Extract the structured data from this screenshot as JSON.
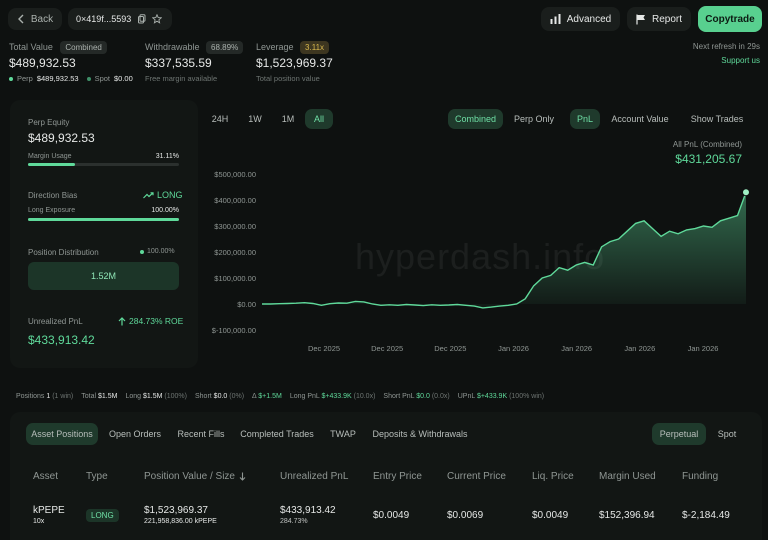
{
  "header": {
    "back_label": "Back",
    "address": "0×419f...5593",
    "advanced_label": "Advanced",
    "report_label": "Report",
    "copytrade_label": "Copytrade",
    "refresh_text": "Next refresh in 29s",
    "support_label": "Support us"
  },
  "summary": {
    "total_value_label": "Total Value",
    "total_value_badge": "Combined",
    "total_value": "$489,932.53",
    "perp_label": "Perp",
    "perp_value": "$489,932.53",
    "spot_label": "Spot",
    "spot_value": "$0.00",
    "withdrawable_label": "Withdrawable",
    "withdrawable_pct": "68.89%",
    "withdrawable_value": "$337,535.59",
    "withdrawable_sub": "Free margin available",
    "leverage_label": "Leverage",
    "leverage_badge": "3.11x",
    "leverage_value": "$1,523,969.37",
    "leverage_sub": "Total position value"
  },
  "left_panel": {
    "perp_equity_label": "Perp Equity",
    "perp_equity_value": "$489,932.53",
    "margin_usage_label": "Margin Usage",
    "margin_usage_value": "31.11%",
    "margin_usage_fraction": 0.3111,
    "direction_bias_label": "Direction Bias",
    "direction_bias_value": "LONG",
    "long_exposure_label": "Long Exposure",
    "long_exposure_value": "100.00%",
    "long_exposure_fraction": 1.0,
    "position_distribution_label": "Position Distribution",
    "position_distribution_value": "100.00%",
    "position_distribution_amount": "1.52M",
    "unrealized_pnl_label": "Unrealized PnL",
    "unrealized_roe": "284.73% ROE",
    "unrealized_pnl_value": "$433,913.42"
  },
  "chart_controls": {
    "ranges": [
      "24H",
      "1W",
      "1M",
      "All"
    ],
    "active_range": "All",
    "modes": [
      "Combined",
      "Perp Only"
    ],
    "active_mode": "Combined",
    "metrics": [
      "PnL",
      "Account Value"
    ],
    "active_metric": "PnL",
    "show_trades_label": "Show Trades",
    "pnl_title": "All PnL (Combined)",
    "pnl_value": "$431,205.67",
    "watermark": "hyperdash.info"
  },
  "chart_data": {
    "type": "area",
    "title": "All PnL (Combined)",
    "y_ticks": [
      "$500,000.00",
      "$400,000.00",
      "$300,000.00",
      "$200,000.00",
      "$100,000.00",
      "$0.00",
      "$-100,000.00"
    ],
    "y_tick_values": [
      500000,
      400000,
      300000,
      200000,
      100000,
      0,
      -100000
    ],
    "x_ticks": [
      "Dec 2025",
      "Dec 2025",
      "Dec 2025",
      "Jan 2026",
      "Jan 2026",
      "Jan 2026",
      "Jan 2026"
    ],
    "ylim": [
      -100000,
      500000
    ],
    "series": [
      {
        "values": [
          0,
          0,
          1000,
          2000,
          3000,
          5000,
          2000,
          -5000,
          1000,
          4000,
          3000,
          10000,
          8000,
          0,
          -5000,
          -3000,
          -5000,
          -2000,
          -4000,
          -6000,
          -3000,
          -5000,
          -4000,
          -2000,
          -5000,
          -8000,
          -15000,
          -12000,
          -8000,
          -5000,
          0,
          20000,
          70000,
          100000,
          110000,
          140000,
          130000,
          150000,
          160000,
          150000,
          220000,
          240000,
          250000,
          280000,
          310000,
          320000,
          290000,
          260000,
          280000,
          270000,
          285000,
          290000,
          300000,
          295000,
          320000,
          330000,
          340000,
          430000
        ]
      }
    ],
    "color": "#5fd99a"
  },
  "positions_bar": {
    "positions_label": "Positions",
    "positions_value": "1",
    "positions_sub": "(1 win)",
    "total_label": "Total",
    "total_value": "$1.5M",
    "long_label": "Long",
    "long_value": "$1.5M",
    "long_pct": "(100%)",
    "short_label": "Short",
    "short_value": "$0.0",
    "short_pct": "(0%)",
    "delta_value": "$+1.5M",
    "long_pnl_label": "Long PnL",
    "long_pnl_value": "$+433.9K",
    "long_pnl_pct": "(10.0x)",
    "short_pnl_label": "Short PnL",
    "short_pnl_value": "$0.0",
    "short_pnl_pct": "(0.0x)",
    "upnl_label": "UPnL",
    "upnl_value": "$+433.9K",
    "upnl_pct": "(100% win)"
  },
  "tabs": {
    "items": [
      "Asset Positions",
      "Open Orders",
      "Recent Fills",
      "Completed Trades",
      "TWAP",
      "Deposits & Withdrawals"
    ],
    "active": "Asset Positions",
    "market_items": [
      "Perpetual",
      "Spot"
    ],
    "active_market": "Perpetual"
  },
  "table": {
    "headers": [
      "Asset",
      "Type",
      "Position Value / Size",
      "Unrealized PnL",
      "Entry Price",
      "Current Price",
      "Liq. Price",
      "Margin Used",
      "Funding"
    ],
    "row": {
      "asset": "kPEPE",
      "leverage": "10x",
      "type": "LONG",
      "position_value": "$1,523,969.37",
      "position_size": "221,958,836.00 kPEPE",
      "pnl": "$433,913.42",
      "pnl_pct": "284.73%",
      "entry_price": "$0.0049",
      "current_price": "$0.0069",
      "liq_price": "$0.0049",
      "margin_used": "$152,396.94",
      "funding": "$-2,184.49"
    }
  }
}
